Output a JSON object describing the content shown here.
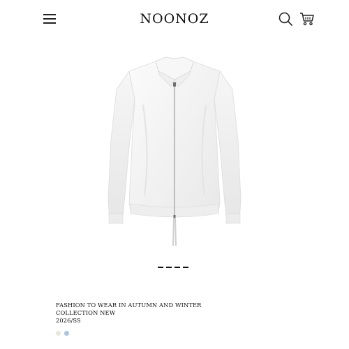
{
  "header": {
    "brand": "NOONOZ",
    "icons": [
      "menu-icon",
      "search-icon",
      "cart-icon"
    ]
  },
  "product": {
    "image_subject": "white zip-up shirt jacket",
    "title_line1": "FASHION TO WEAR IN AUTUMN AND WINTER",
    "title_line2": "COLLECTION NEW",
    "season": "2026/SS",
    "gallery_count": 4,
    "swatches": [
      {
        "color": "#e9e6da"
      },
      {
        "color": "#a7c4e6"
      }
    ]
  },
  "colors": {
    "background": "#ffffff",
    "text": "#111111"
  }
}
